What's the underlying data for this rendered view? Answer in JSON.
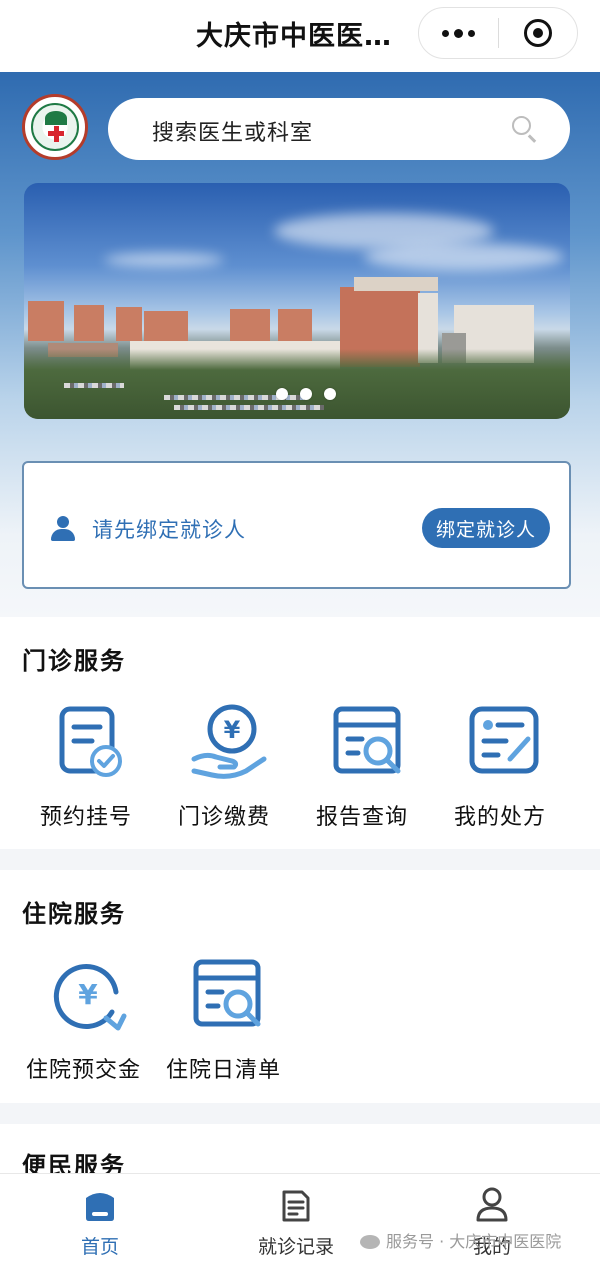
{
  "navbar": {
    "title": "大庆市中医医…",
    "capsule_more_icon": "more-dots-icon",
    "capsule_close_icon": "target-close-icon"
  },
  "header": {
    "logo_icon": "hospital-logo-icon",
    "search": {
      "placeholder": "搜索医生或科室",
      "icon": "search-icon"
    }
  },
  "banner": {
    "image": "hospital-building-photo",
    "dots_count": 3
  },
  "bind_card": {
    "prompt": "请先绑定就诊人",
    "icon": "user-icon",
    "button_label": "绑定就诊人"
  },
  "outpatient": {
    "title": "门诊服务",
    "items": [
      {
        "label": "预约挂号",
        "icon": "appointment-icon"
      },
      {
        "label": "门诊缴费",
        "icon": "payment-icon"
      },
      {
        "label": "报告查询",
        "icon": "report-search-icon"
      },
      {
        "label": "我的处方",
        "icon": "prescription-icon"
      }
    ]
  },
  "inpatient": {
    "title": "住院服务",
    "items": [
      {
        "label": "住院预交金",
        "icon": "deposit-icon"
      },
      {
        "label": "住院日清单",
        "icon": "daily-list-icon"
      }
    ]
  },
  "convenience": {
    "title": "便民服务"
  },
  "tabbar": {
    "items": [
      {
        "label": "首页",
        "icon": "home-icon",
        "active": true
      },
      {
        "label": "就诊记录",
        "icon": "records-icon",
        "active": false
      },
      {
        "label": "我的",
        "icon": "profile-icon",
        "active": false
      }
    ]
  },
  "watermark": "服务号 · 大庆市中医医院",
  "colors": {
    "accent": "#2f6fb4",
    "hero_top": "#2f6bb0"
  }
}
